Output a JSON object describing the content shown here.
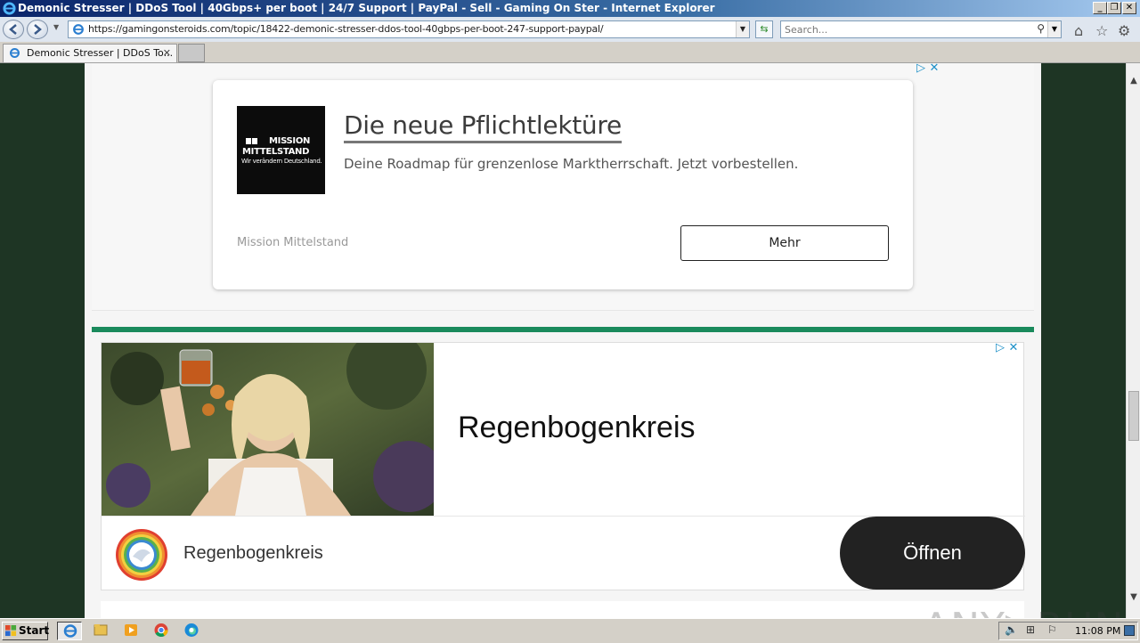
{
  "window": {
    "title": "Demonic Stresser | DDoS Tool | 40Gbps+ per boot | 24/7 Support | PayPal - Sell - Gaming On Ster - Internet Explorer",
    "minimize": "_",
    "restore": "❐",
    "close": "✕"
  },
  "address_bar": {
    "url": "https://gamingonsteroids.com/topic/18422-demonic-stresser-ddos-tool-40gbps-per-boot-247-support-paypal/",
    "search_placeholder": "Search..."
  },
  "tabs": [
    {
      "label": "Demonic Stresser | DDoS To...",
      "close": "✕"
    }
  ],
  "ad1": {
    "adchoices": "▷ ✕",
    "logo_line1": "MISSION",
    "logo_line2": "MITTELSTAND",
    "logo_line3": "Wir verändern Deutschland.",
    "title": "Die neue Pflichtlektüre",
    "description": "Deine Roadmap für grenzenlose Marktherrschaft. Jetzt vorbestellen.",
    "advertiser": "Mission Mittelstand",
    "cta": "Mehr"
  },
  "ad2": {
    "adchoices": "▷ ✕",
    "headline": "Regenbogenkreis",
    "advertiser": "Regenbogenkreis",
    "cta": "Öffnen"
  },
  "watermark": "ANY▷RUN",
  "taskbar": {
    "start_label": "Start",
    "clock": "11:08 PM",
    "apps": [
      "internet-explorer",
      "file-explorer",
      "media-player",
      "chrome",
      "edge"
    ]
  },
  "colors": {
    "page_background": "#1e3524",
    "divider_green": "#1a8a5c",
    "ad_cta_dark": "#222222"
  }
}
